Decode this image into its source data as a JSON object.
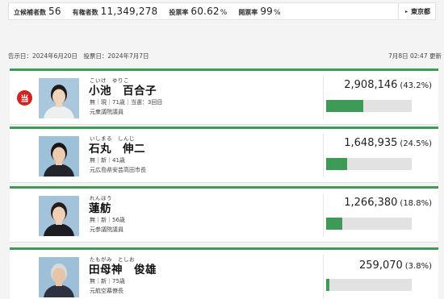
{
  "stats": {
    "candidates_label": "立候補者数",
    "candidates_value": "56",
    "voters_label": "有権者数",
    "voters_value": "11,349,278",
    "turnout_label": "投票率",
    "turnout_value": "60.62",
    "turnout_unit": "%",
    "counted_label": "開票率",
    "counted_value": "99",
    "counted_unit": "%"
  },
  "region": {
    "arrow": "▸",
    "label": "東京都"
  },
  "meta": {
    "announce": "告示日：2024年6月20日　投票日：2024年7月7日",
    "updated": "7月8日 02:47 更新"
  },
  "elected_badge": "当",
  "candidates": [
    {
      "ruby": "こいけ　ゆりこ",
      "name": "小池　百合子",
      "attrs": "無｜現｜71歳｜当選：3回目",
      "career": "元衆議院議員",
      "votes": "2,908,146",
      "pct": "(43.2%)",
      "share": 43.2,
      "elected": true,
      "photo_bg": "#a9c8dd",
      "suit": "#eef0ef",
      "hair": "#1d1a18",
      "skin": "#f0d3bd"
    },
    {
      "ruby": "いしまる　しんじ",
      "name": "石丸　伸二",
      "attrs": "無｜新｜41歳",
      "career": "元広島県安芸高田市長",
      "votes": "1,648,935",
      "pct": "(24.5%)",
      "share": 24.5,
      "elected": false,
      "photo_bg": "#9cc1d9",
      "suit": "#23252d",
      "hair": "#18161a",
      "skin": "#edcbb0"
    },
    {
      "ruby": "れんほう",
      "name": "蓮舫",
      "attrs": "無｜新｜56歳",
      "career": "元参議院議員",
      "votes": "1,266,380",
      "pct": "(18.8%)",
      "share": 18.8,
      "elected": false,
      "photo_bg": "#a3c3da",
      "suit": "#1c1c22",
      "hair": "#231c18",
      "skin": "#efcfb6"
    },
    {
      "ruby": "たもがみ　としお",
      "name": "田母神　俊雄",
      "attrs": "無｜新｜75歳",
      "career": "元航空幕僚長",
      "votes": "259,070",
      "pct": "(3.8%)",
      "share": 3.8,
      "elected": false,
      "photo_bg": "#9dbfd8",
      "suit": "#2e3140",
      "hair": "#d9d9d9",
      "skin": "#e8c4a6"
    }
  ]
}
